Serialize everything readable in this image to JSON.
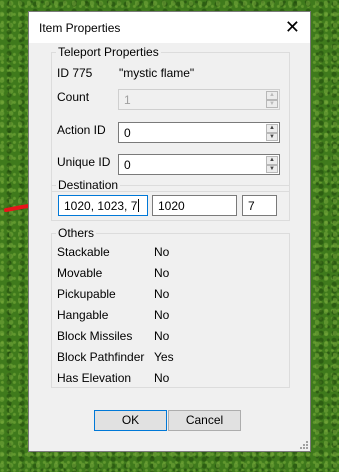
{
  "dialog": {
    "title": "Item Properties"
  },
  "teleport": {
    "legend": "Teleport Properties",
    "id_label": "ID 775",
    "item_name": "\"mystic flame\"",
    "count_label": "Count",
    "count_value": "1",
    "action_id_label": "Action ID",
    "action_id_value": "0",
    "unique_id_label": "Unique ID",
    "unique_id_value": "0"
  },
  "destination": {
    "legend": "Destination",
    "combined_value": "1020, 1023, 7",
    "x_value": "1020",
    "z_value": "7"
  },
  "others": {
    "legend": "Others",
    "rows": [
      {
        "label": "Stackable",
        "value": "No"
      },
      {
        "label": "Movable",
        "value": "No"
      },
      {
        "label": "Pickupable",
        "value": "No"
      },
      {
        "label": "Hangable",
        "value": "No"
      },
      {
        "label": "Block Missiles",
        "value": "No"
      },
      {
        "label": "Block Pathfinder",
        "value": "Yes"
      },
      {
        "label": "Has Elevation",
        "value": "No"
      }
    ]
  },
  "buttons": {
    "ok": "OK",
    "cancel": "Cancel"
  },
  "colors": {
    "accent": "#0078d7",
    "annotation": "#e8141a",
    "background": "#3f7a1c"
  }
}
